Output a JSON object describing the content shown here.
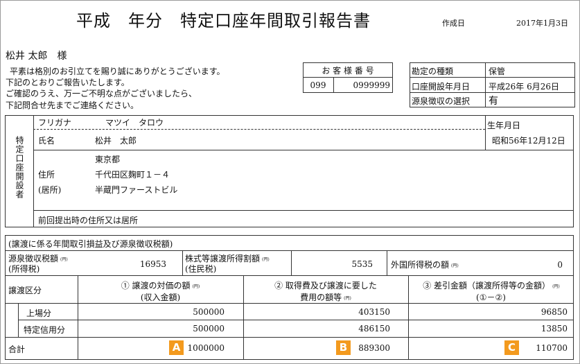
{
  "header": {
    "title": "平成　年分　特定口座年間取引報告書",
    "created_label": "作成日",
    "created_date": "2017年1月3日"
  },
  "recipient": {
    "name": "松井 太郎　様",
    "greeting_lines": [
      "平素は格別のお引立てを賜り誠にありがとうございます。",
      "下記のとおりご報告いたします。",
      "ご確認のうえ、万一ご不明な点がございましたら、",
      "下記問合せ先までご連絡ください。"
    ]
  },
  "customer_number": {
    "label": "お 客 様 番 号",
    "branch": "099",
    "number": "0999999"
  },
  "account_info": {
    "rows": [
      {
        "label": "勘定の種類",
        "value": "保管"
      },
      {
        "label": "口座開設年月日",
        "value": "平成26年 6月26日"
      },
      {
        "label": "源泉徴収の選択",
        "value": "有"
      }
    ]
  },
  "account_holder": {
    "section_label": "特定口座開設者",
    "furigana_label": "フリガナ",
    "furigana_value": "マツイ　タロウ",
    "name_label": "氏名",
    "name_value": "松井　太郎",
    "birthdate_label": "生年月日",
    "birthdate_value": "昭和56年12月12日",
    "address_label1": "住所",
    "address_label2": "(居所)",
    "address_lines": [
      "東京都",
      "千代田区麹町１－４",
      "半蔵門ファーストビル"
    ],
    "previous_address_label": "前回提出時の住所又は居所"
  },
  "summary": {
    "section_title": "(譲渡に係る年間取引損益及び源泉徴収税額)",
    "withholding_label1": "源泉徴収税額",
    "withholding_label2": "(所得税)",
    "withholding_value": "16953",
    "resident_label1": "株式等譲渡所得割額",
    "resident_label2": "(住民税)",
    "resident_value": "5535",
    "foreign_label": "外国所得税の額",
    "foreign_value": "0",
    "yen": "(円)"
  },
  "transfer_table": {
    "category_label": "譲渡区分",
    "col1_line1": "① 譲渡の対価の額",
    "col1_line2": "(収入金額)",
    "col2_line1": "② 取得費及び譲渡に要した",
    "col2_line2": "費用の額等",
    "col3_line1": "③ 差引金額（譲渡所得等の金額）",
    "col3_line2": "(①－②)",
    "rows": [
      {
        "label": "上場分",
        "v1": "500000",
        "v2": "403150",
        "v3": "96850"
      },
      {
        "label": "特定信用分",
        "v1": "500000",
        "v2": "486150",
        "v3": "13850"
      }
    ],
    "total_label": "合計",
    "total_v1": "1000000",
    "total_v2": "889300",
    "total_v3": "110700",
    "badges": [
      "A",
      "B",
      "C"
    ]
  }
}
